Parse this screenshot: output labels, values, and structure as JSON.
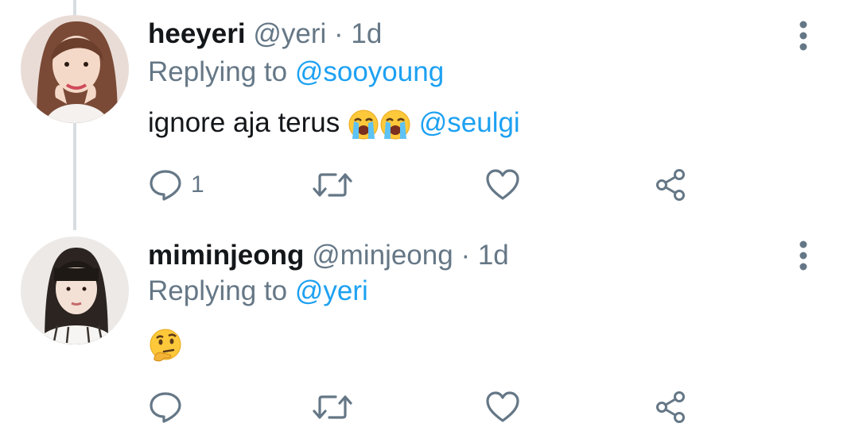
{
  "colors": {
    "accent": "#1da1f2",
    "secondary_text": "#657786",
    "primary_text": "#14171a",
    "thread_line": "#d8dde1"
  },
  "tweets": [
    {
      "display_name": "heeyeri",
      "handle": "@yeri",
      "separator": "·",
      "time": "1d",
      "replying_prefix": "Replying to",
      "replying_to": "@sooyoung",
      "text": "ignore aja terus",
      "emojis": [
        "loudly-crying-face",
        "loudly-crying-face"
      ],
      "trailing_mention": "@seulgi",
      "reply_count": "1",
      "icons": [
        "reply-icon",
        "retweet-icon",
        "like-icon",
        "share-icon",
        "more-options-icon"
      ]
    },
    {
      "display_name": "miminjeong",
      "handle": "@minjeong",
      "separator": "·",
      "time": "1d",
      "replying_prefix": "Replying to",
      "replying_to": "@yeri",
      "emojis": [
        "thinking-face"
      ],
      "reply_count": "",
      "icons": [
        "reply-icon",
        "retweet-icon",
        "like-icon",
        "share-icon",
        "more-options-icon"
      ]
    }
  ]
}
